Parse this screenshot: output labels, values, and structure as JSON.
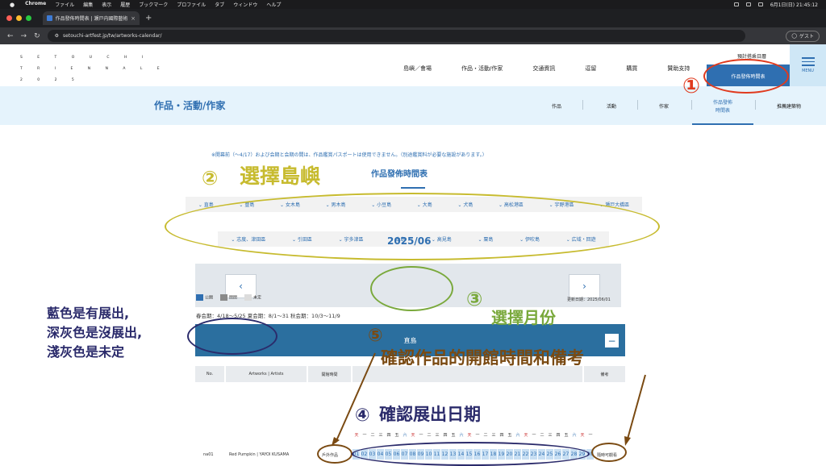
{
  "mac": {
    "menus": [
      "Chrome",
      "ファイル",
      "編集",
      "表示",
      "履歴",
      "ブックマーク",
      "プロファイル",
      "タブ",
      "ウィンドウ",
      "ヘルプ"
    ],
    "clock": "6月1日(日) 21:45:12"
  },
  "tab": {
    "title": "作品發佈時間表 | 瀬戸内國際藝術祭"
  },
  "address": {
    "url": "setouchi-artfest.jp/tw/artworks-calendar/",
    "profile": "ゲスト"
  },
  "site": {
    "logo": [
      "S E T O U C H I",
      "T R I E N N A L E",
      "2 0 2 5"
    ],
    "nav": [
      "島嶼／會場",
      "作品・活動/作家",
      "交通資訊",
      "逗留",
      "購買",
      "贊助支持"
    ],
    "visit_label": "預計搭乘日曆",
    "calendar_btn": "作品發佈時間表",
    "menu_label": "MENU",
    "section_title": "作品・活動/作家",
    "subnav": [
      "作品",
      "活動",
      "作家"
    ],
    "subnav_active_l1": "作品發佈",
    "subnav_active_l2": "時間表",
    "subnav_last": "推薦建築物",
    "notice": "※開幕前（〜4/17）および会期と会期の間は、作品鑑賞パスポートは使用できません。（別途鑑賞料が必要な施設があります。）",
    "calendar_title": "作品發佈時間表",
    "islands_row1": [
      "直島",
      "豊島",
      "女木島",
      "男木島",
      "小豆島",
      "大島",
      "犬島",
      "高松港區",
      "宇野港區",
      "瀬戸大橋區"
    ],
    "islands_row2": [
      "志度、津田區",
      "引田區",
      "宇多津區",
      "本島",
      "高見島",
      "粟島",
      "伊吹島",
      "広域・回遊"
    ],
    "month": "2025/06",
    "legend": [
      "公開",
      "閉閉",
      "未定"
    ],
    "updated": "更新日期：2025/06/01",
    "sessions": "春会期：4/18〜5/25 夏会期：8/1〜31 秋会期：10/3〜11/9",
    "island_header": "直島",
    "col_no": "No.",
    "col_art": "Artworks | Artists",
    "col_hours": "開館時間",
    "col_notes": "備考",
    "weekdays": [
      "天",
      "一",
      "二",
      "三",
      "四",
      "五",
      "六",
      "天",
      "一",
      "二",
      "三",
      "四",
      "五",
      "六",
      "天",
      "一",
      "二",
      "三",
      "四",
      "五",
      "六",
      "天",
      "一",
      "二",
      "三",
      "四",
      "五",
      "六",
      "天",
      "一"
    ],
    "dates": [
      "01",
      "02",
      "03",
      "04",
      "05",
      "06",
      "07",
      "08",
      "09",
      "10",
      "11",
      "12",
      "13",
      "14",
      "15",
      "16",
      "17",
      "18",
      "19",
      "20",
      "21",
      "22",
      "23",
      "24",
      "25",
      "26",
      "27",
      "28",
      "29",
      "30"
    ],
    "row_no": "na01",
    "row_art": "Red Pumpkin | YAYOI KUSAMA",
    "row_hours": "戶外作品",
    "row_notes": "隨時可觀看"
  },
  "annotations": {
    "n1": "①",
    "n2": "②",
    "a2": "選擇島嶼",
    "n3": "③",
    "a3": "選擇月份",
    "legend_l1": "藍色是有展出,",
    "legend_l2": "深灰色是沒展出,",
    "legend_l3": "淺灰色是未定",
    "n5": "⑤",
    "a5": "確認作品的開館時間和備考",
    "n4": "④",
    "a4": "確認展出日期"
  },
  "colors": {
    "brand_blue": "#2f6fb1",
    "header_teal": "#2b6f9f",
    "ann_red": "#e03a1e",
    "ann_olive": "#c7bb2f",
    "ann_green": "#7aa93c",
    "ann_navy": "#2b2b6b",
    "ann_brown": "#7a4a12"
  }
}
